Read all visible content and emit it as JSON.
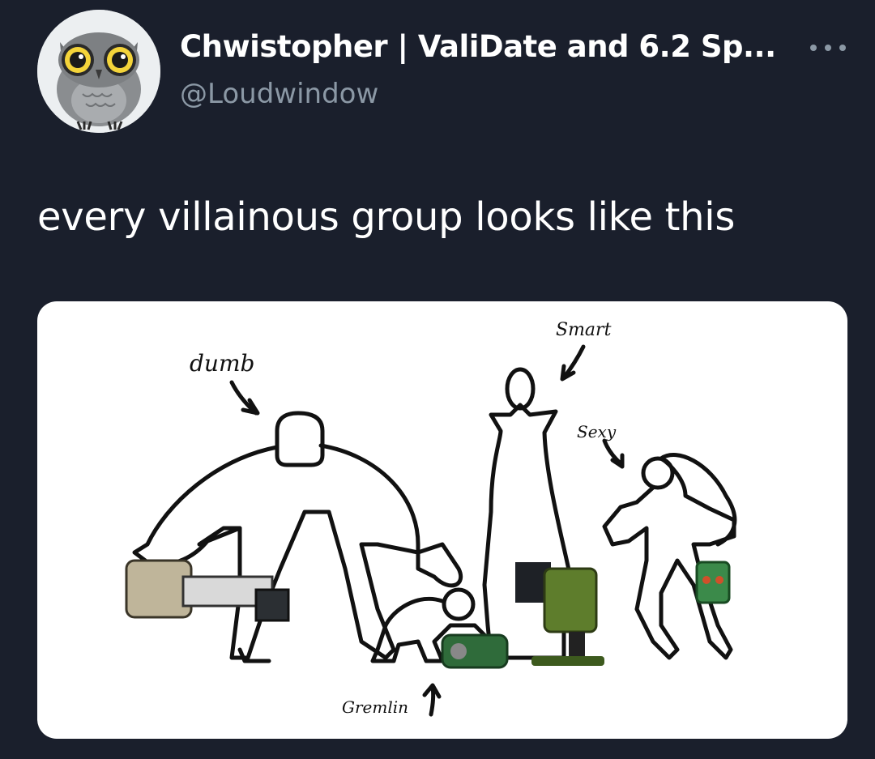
{
  "tweet": {
    "display_name": "Chwistopher | ValiDate and 6.2 Sp...",
    "handle": "@Loudwindow",
    "text": "every villainous group looks like this",
    "more_icon": "more-horizontal-icon",
    "avatar_icon": "owl-avatar-icon"
  },
  "image": {
    "labels": {
      "dumb": "dumb",
      "smart": "Smart",
      "sexy": "Sexy",
      "gremlin": "Gremlin"
    }
  },
  "colors": {
    "background": "#1a1f2c",
    "secondary_text": "#8b98a5",
    "text": "#ffffff"
  }
}
